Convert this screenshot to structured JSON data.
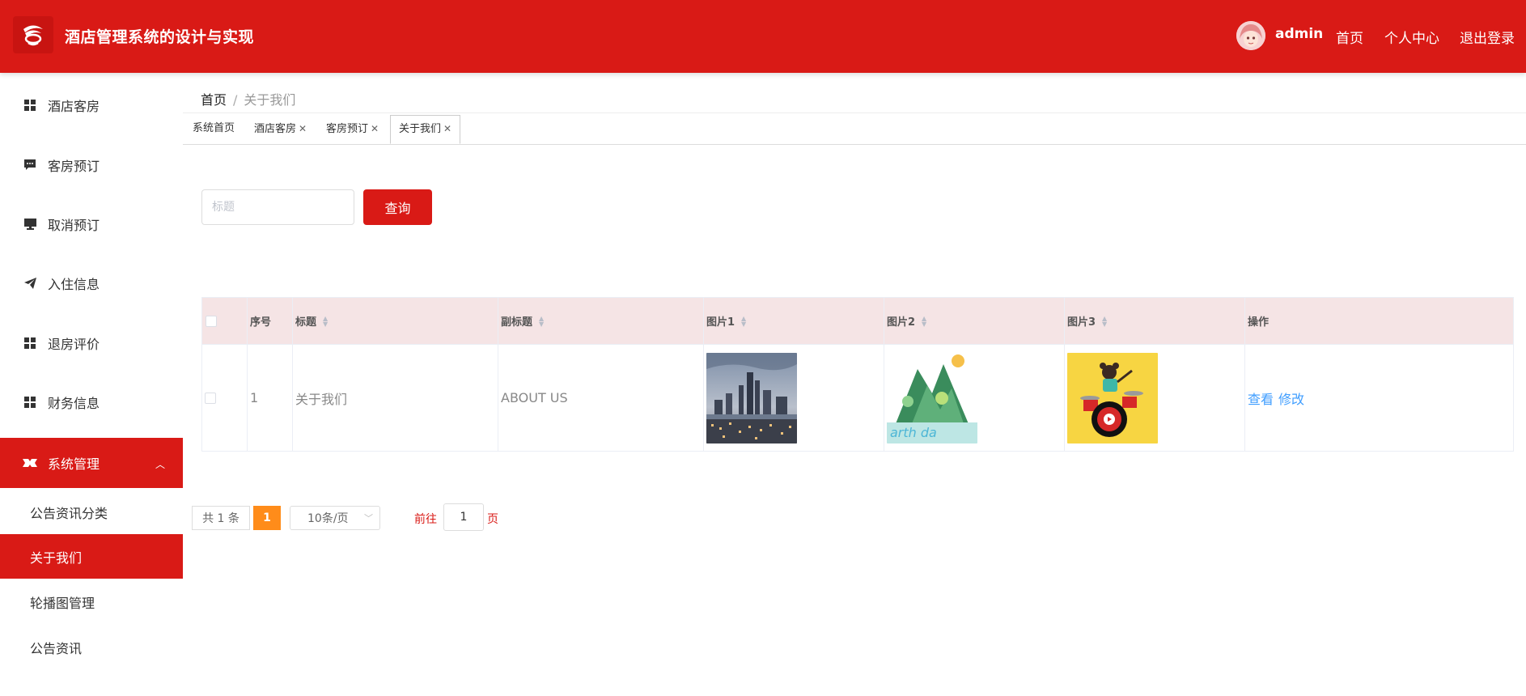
{
  "header": {
    "app_title": "酒店管理系统的设计与实现",
    "user": "admin",
    "links": [
      "首页",
      "个人中心",
      "退出登录"
    ]
  },
  "sidebar": {
    "items": [
      {
        "label": "酒店客房",
        "icon": "grid-icon"
      },
      {
        "label": "客房预订",
        "icon": "chat-icon"
      },
      {
        "label": "取消预订",
        "icon": "monitor-icon"
      },
      {
        "label": "入住信息",
        "icon": "send-icon"
      },
      {
        "label": "退房评价",
        "icon": "grid-icon"
      },
      {
        "label": "财务信息",
        "icon": "grid-icon"
      },
      {
        "label": "系统管理",
        "icon": "ticket-icon",
        "active": true
      }
    ],
    "sub_items": [
      {
        "label": "公告资讯分类"
      },
      {
        "label": "关于我们",
        "active": true
      },
      {
        "label": "轮播图管理"
      },
      {
        "label": "公告资讯"
      }
    ]
  },
  "breadcrumb": {
    "home": "首页",
    "separator": "/",
    "current": "关于我们"
  },
  "tabs": [
    "系统首页",
    "酒店客房",
    "客房预订",
    "关于我们"
  ],
  "search": {
    "placeholder": "标题",
    "button": "查询"
  },
  "table": {
    "columns": [
      "序号",
      "标题",
      "副标题",
      "图片1",
      "图片2",
      "图片3",
      "操作"
    ],
    "rows": [
      {
        "index": "1",
        "title": "关于我们",
        "subtitle": "ABOUT US",
        "actions": [
          "查看",
          "修改"
        ]
      }
    ]
  },
  "pagination": {
    "total": "共 1 条",
    "current_page": "1",
    "page_size": "10条/页",
    "goto_label": "前往",
    "goto_value": "1",
    "page_label": "页"
  },
  "colors": {
    "primary": "#d91a16",
    "header_bg": "#f5e4e5",
    "link": "#409eff",
    "page_active": "#ff8c1a"
  }
}
